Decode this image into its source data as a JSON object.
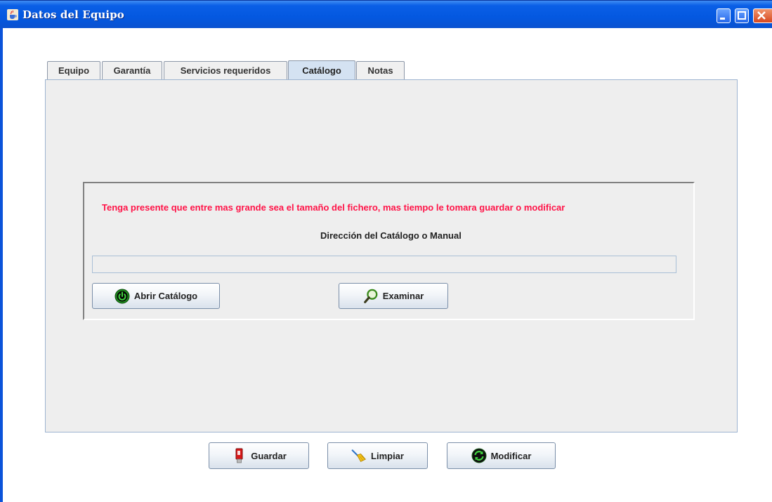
{
  "window": {
    "title": "Datos del Equipo"
  },
  "tabs": [
    {
      "label": "Equipo"
    },
    {
      "label": "Garantía"
    },
    {
      "label": "Servicios requeridos"
    },
    {
      "label": "Catálogo",
      "active": true
    },
    {
      "label": "Notas"
    }
  ],
  "catalog_panel": {
    "warning": "Tenga presente que entre mas grande sea el tamaño del fichero, mas tiempo le tomara guardar o modificar",
    "path_label": "Dirección del Catálogo o Manual",
    "path_value": "",
    "open_button": "Abrir Catálogo",
    "browse_button": "Examinar"
  },
  "actions": {
    "save": "Guardar",
    "clear": "Limpiar",
    "modify": "Modificar"
  },
  "colors": {
    "titlebar": "#0458e0",
    "warning_text": "#ff1448",
    "panel_bg": "#eeeeee",
    "active_tab": "#d4e2f2"
  },
  "icons": {
    "app": "java-cup-icon",
    "open": "power-icon",
    "browse": "magnifier-icon",
    "save": "usb-drive-icon",
    "clear": "broom-icon",
    "modify": "refresh-icon"
  }
}
